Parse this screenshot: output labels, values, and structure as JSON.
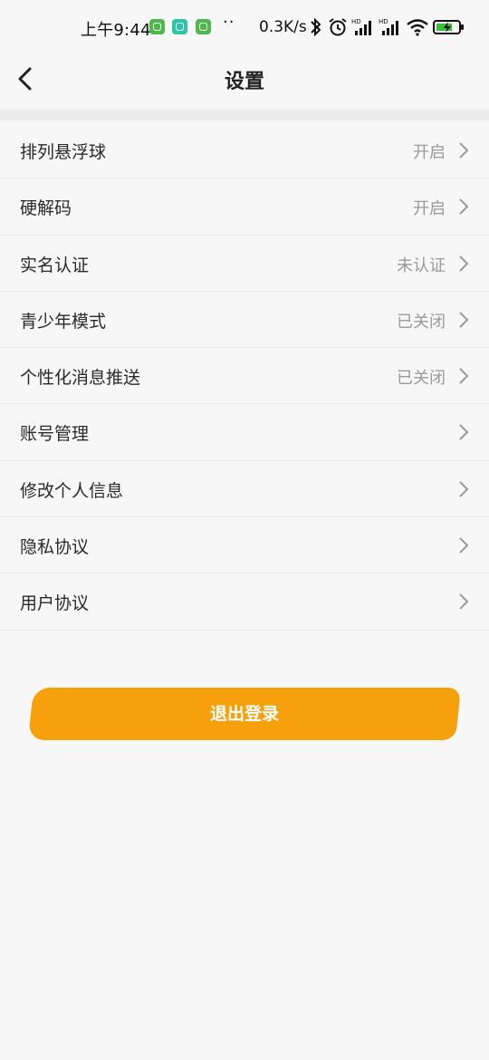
{
  "status_bar": {
    "time": "上午9:44",
    "dots": "··",
    "net_speed": "0.3K/s",
    "icons": [
      "app-notification-icon",
      "mi-app-icon",
      "app-notification-icon",
      "bluetooth-icon",
      "alarm-icon",
      "signal-hd-icon",
      "signal-hd-icon",
      "wifi-icon",
      "battery-charging-icon"
    ]
  },
  "header": {
    "title": "设置",
    "back_icon": "chevron-left-icon"
  },
  "settings": {
    "items": [
      {
        "label": "排列悬浮球",
        "value": "开启"
      },
      {
        "label": "硬解码",
        "value": "开启"
      },
      {
        "label": "实名认证",
        "value": "未认证"
      },
      {
        "label": "青少年模式",
        "value": "已关闭"
      },
      {
        "label": "个性化消息推送",
        "value": "已关闭"
      },
      {
        "label": "账号管理",
        "value": ""
      },
      {
        "label": "修改个人信息",
        "value": ""
      },
      {
        "label": "隐私协议",
        "value": ""
      },
      {
        "label": "用户协议",
        "value": ""
      }
    ]
  },
  "logout": {
    "label": "退出登录"
  },
  "colors": {
    "accent": "#f6a00c",
    "background": "#f7f7f7",
    "secondary_text": "#9a9a9a"
  }
}
